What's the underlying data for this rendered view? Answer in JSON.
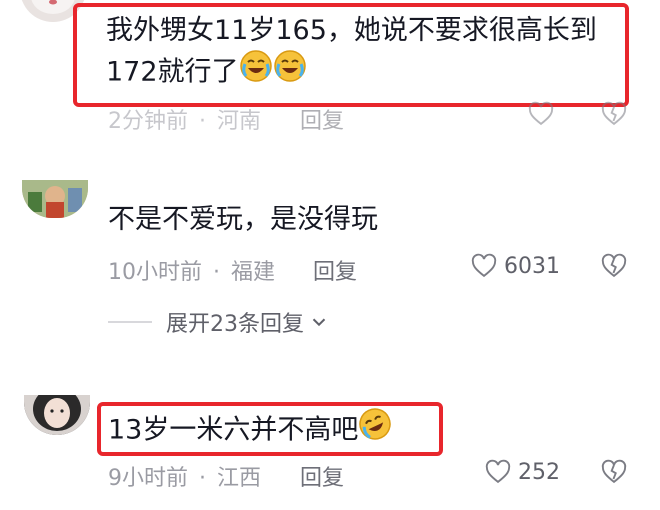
{
  "comments": [
    {
      "text_line1": "我外甥女11岁165，她说不要求很高长到",
      "text_line2": "172就行了",
      "time": "2分钟前",
      "location": "河南",
      "reply_label": "回复",
      "emoji": "crying-laughing-emoji"
    },
    {
      "text": "不是不爱玩，是没得玩",
      "time": "10小时前",
      "location": "福建",
      "reply_label": "回复",
      "likes": "6031",
      "expand_label": "展开23条回复"
    },
    {
      "text": "13岁一米六并不高吧",
      "time": "9小时前",
      "location": "江西",
      "reply_label": "回复",
      "likes": "252",
      "emoji": "rolling-laughing-emoji"
    }
  ],
  "separator": "·",
  "colors": {
    "highlight_box": "#e8262c",
    "text": "#161823",
    "meta": "#9a9ba3"
  },
  "icons": [
    "heart-outline-icon",
    "broken-heart-icon",
    "chevron-down-icon"
  ]
}
